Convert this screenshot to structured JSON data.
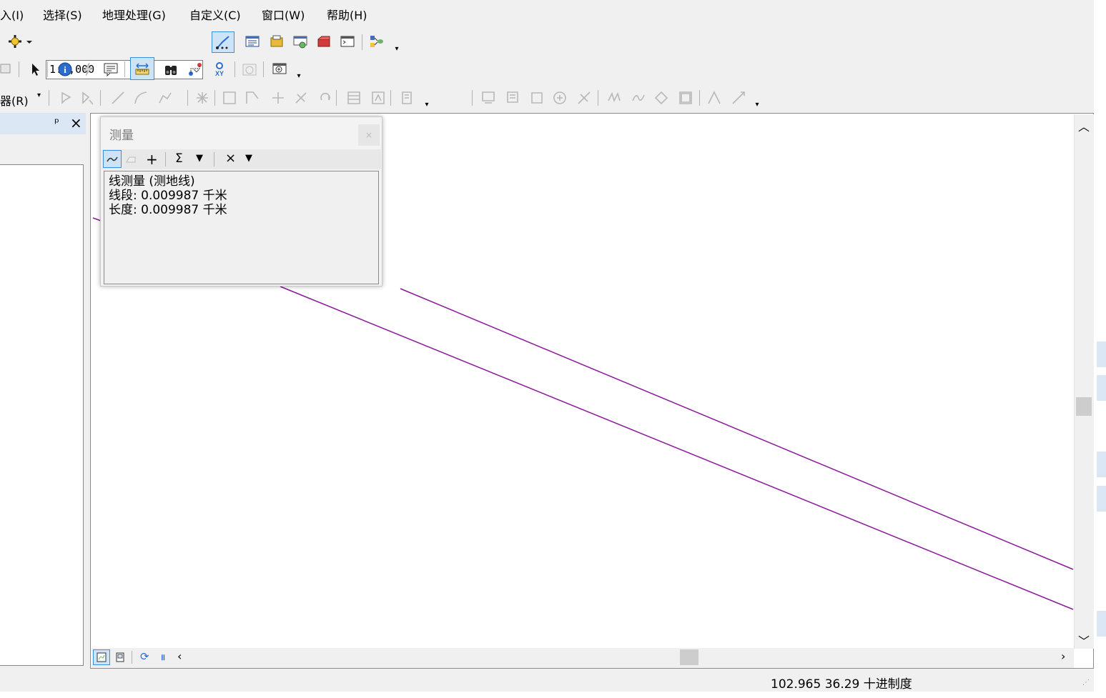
{
  "menubar": {
    "items": [
      "入(I)",
      "选择(S)",
      "地理处理(G)",
      "自定义(C)",
      "窗口(W)",
      "帮助(H)"
    ]
  },
  "toolbar": {
    "scale_value": "1:1,000",
    "editor_label": "器(R)"
  },
  "measure_dialog": {
    "title": "测量",
    "close_label": "×",
    "result_title": "线测量 (测地线)",
    "segment_line": "线段: 0.009987 千米",
    "length_line": "长度: 0.009987 千米",
    "tools": {
      "sum_label": "Σ",
      "clear_label": "×",
      "add_label": "+"
    }
  },
  "left_panel": {
    "pin_label": "ᵖ",
    "close_label": "×"
  },
  "status": {
    "coordinates": "102.965  36.29 十进制度"
  },
  "colors": {
    "line_color": "#8b1a9a",
    "panel_title_bg": "#dbe7f4",
    "active_tool": "#cde3f7"
  }
}
